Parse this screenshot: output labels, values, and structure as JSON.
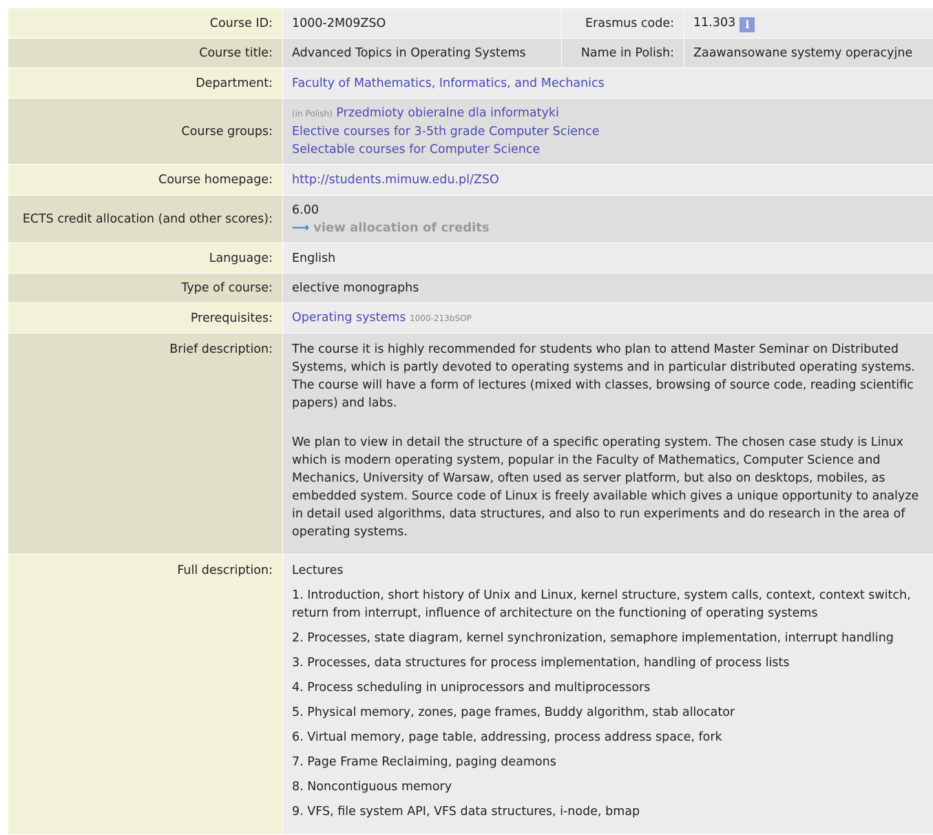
{
  "course_id": {
    "label": "Course ID:",
    "value": "1000-2M09ZSO"
  },
  "erasmus": {
    "label": "Erasmus code:",
    "value": "11.303",
    "info_icon": "info-icon",
    "info_glyph": "i"
  },
  "course_title": {
    "label": "Course title:",
    "value": "Advanced Topics in Operating Systems"
  },
  "name_polish": {
    "label": "Name in Polish:",
    "value": "Zaawansowane systemy operacyjne"
  },
  "department": {
    "label": "Department:",
    "value": "Faculty of Mathematics, Informatics, and Mechanics"
  },
  "course_groups": {
    "label": "Course groups:",
    "in_polish_tag": "(in Polish)",
    "items": [
      "Przedmioty obieralne dla informatyki",
      "Elective courses for 3-5th grade Computer Science",
      "Selectable courses for Computer Science"
    ]
  },
  "homepage": {
    "label": "Course homepage:",
    "value": "http://students.mimuw.edu.pl/ZSO"
  },
  "ects": {
    "label": "ECTS credit allocation (and other scores):",
    "value": "6.00",
    "link": "view allocation of credits",
    "arrow_icon": "arrow-right-icon",
    "arrow_glyph": "⟶"
  },
  "language": {
    "label": "Language:",
    "value": "English"
  },
  "type": {
    "label": "Type of course:",
    "value": "elective monographs"
  },
  "prerequisites": {
    "label": "Prerequisites:",
    "link": "Operating systems",
    "code": "1000-213bSOP"
  },
  "brief": {
    "label": "Brief description:",
    "p1": "The course it is highly recommended for students who plan to attend Master Seminar on Distributed Systems, which is partly devoted to operating systems and in particular distributed operating systems. The course will have a form of lectures (mixed with classes, browsing of source code, reading scientific papers) and labs.",
    "p2": "We plan to view in detail the structure of a specific operating system. The chosen case study is Linux which is modern operating system, popular in the Faculty of Mathematics, Computer Science and Mechanics, University of Warsaw, often used as server platform, but also on desktops, mobiles, as embedded system. Source code of Linux is freely available which gives a unique opportunity to analyze in detail used algorithms, data structures, and also to run experiments and do research in the area of operating systems."
  },
  "full": {
    "label": "Full description:",
    "heading": "Lectures",
    "lectures": [
      "1. Introduction, short history of Unix and Linux, kernel structure, system calls, context, context switch, return from interrupt, influence of architecture on the functioning of operating systems",
      "2. Processes, state diagram, kernel synchronization, semaphore implementation, interrupt handling",
      "3. Processes, data structures for process implementation, handling of process lists",
      "4. Process scheduling in uniprocessors and multiprocessors",
      "5. Physical memory, zones, page frames, Buddy algorithm, stab allocator",
      "6. Virtual memory, page table, addressing, process address space, fork",
      "7. Page Frame Reclaiming, paging deamons",
      "8. Noncontiguous memory",
      "9. VFS, file system API, VFS data structures, i-node, bmap"
    ]
  }
}
